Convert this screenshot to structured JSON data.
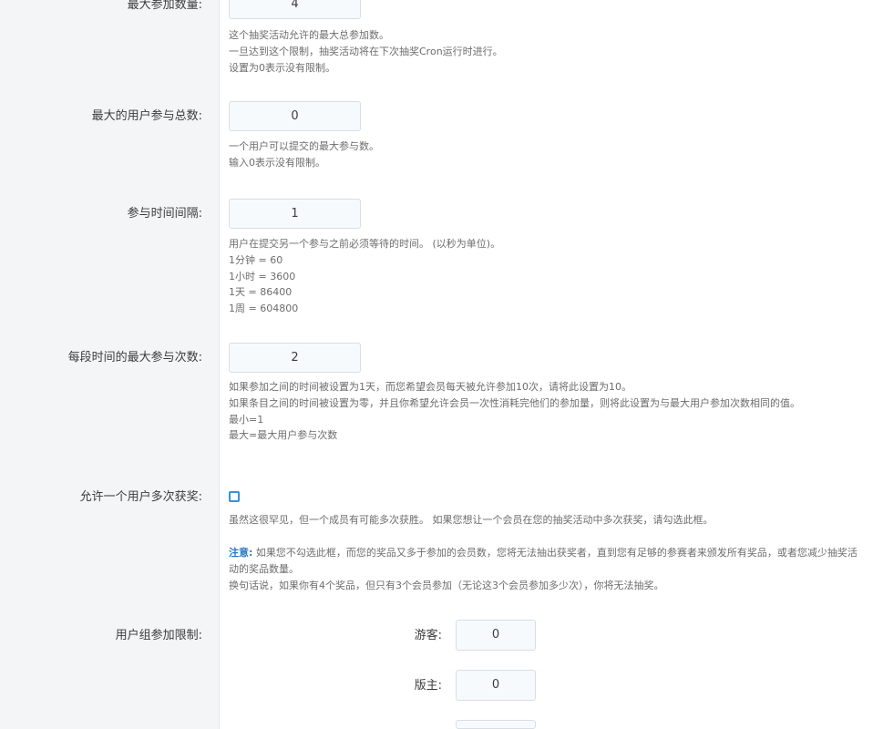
{
  "fields": {
    "max_entries": {
      "label": "最大参加数量:",
      "value": "4",
      "help": [
        "这个抽奖活动允许的最大总参加数。",
        "一旦达到这个限制，抽奖活动将在下次抽奖Cron运行时进行。",
        "设置为0表示没有限制。"
      ]
    },
    "max_user_entries": {
      "label": "最大的用户参与总数:",
      "value": "0",
      "help": [
        "一个用户可以提交的最大参与数。",
        "输入0表示没有限制。"
      ]
    },
    "entry_interval": {
      "label": "参与时间间隔:",
      "value": "1",
      "help": [
        "用户在提交另一个参与之前必须等待的时间。 (以秒为单位)。",
        "1分钟 = 60",
        "1小时 = 3600",
        "1天 = 86400",
        "1周 = 604800"
      ]
    },
    "max_per_period": {
      "label": "每段时间的最大参与次数:",
      "value": "2",
      "help": [
        "如果参加之间的时间被设置为1天，而您希望会员每天被允许参加10次，请将此设置为10。",
        "如果条目之间的时间被设置为零，并且你希望允许会员一次性消耗完他们的参加量，则将此设置为与最大用户参加次数相同的值。",
        "最小=1",
        "最大=最大用户参与次数"
      ]
    },
    "allow_multiple_wins": {
      "label": "允许一个用户多次获奖:",
      "checked": false,
      "help": "虽然这很罕见，但一个成员有可能多次获胜。 如果您想让一个会员在您的抽奖活动中多次获奖，请勾选此框。",
      "note_label": "注意:",
      "note_text": " 如果您不勾选此框，而您的奖品又多于参加的会员数，您将无法抽出获奖者，直到您有足够的参赛者来颁发所有奖品，或者您减少抽奖活动的奖品数量。",
      "note_extra": "换句话说，如果你有4个奖品，但只有3个会员参加（无论这3个会员参加多少次），你将无法抽奖。"
    },
    "usergroup_limits": {
      "label": "用户组参加限制:",
      "groups": [
        {
          "label": "游客:",
          "value": "0"
        },
        {
          "label": "版主:",
          "value": "0"
        },
        {
          "label": "",
          "value": ""
        }
      ]
    }
  }
}
